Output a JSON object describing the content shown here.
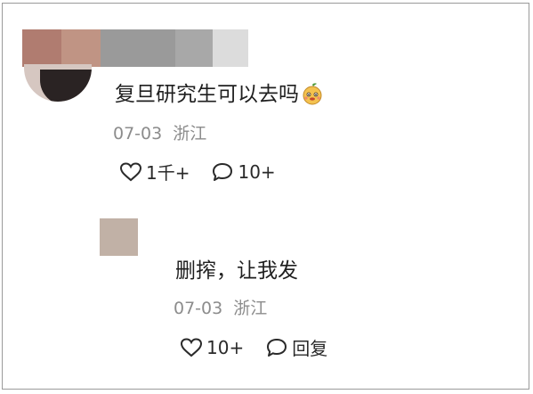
{
  "comments": [
    {
      "text": "复旦研究生可以去吗",
      "emoji": "smiling-orange-emoji",
      "date": "07-03",
      "location": "浙江",
      "likes": "1千+",
      "replies": "10+"
    },
    {
      "text": "删搾，让我发",
      "date": "07-03",
      "location": "浙江",
      "likes": "10+",
      "reply_label": "回复"
    }
  ],
  "colors": {
    "text": "#1f1f1f",
    "meta": "#8c8c8c",
    "icon": "#2a2a2a"
  }
}
